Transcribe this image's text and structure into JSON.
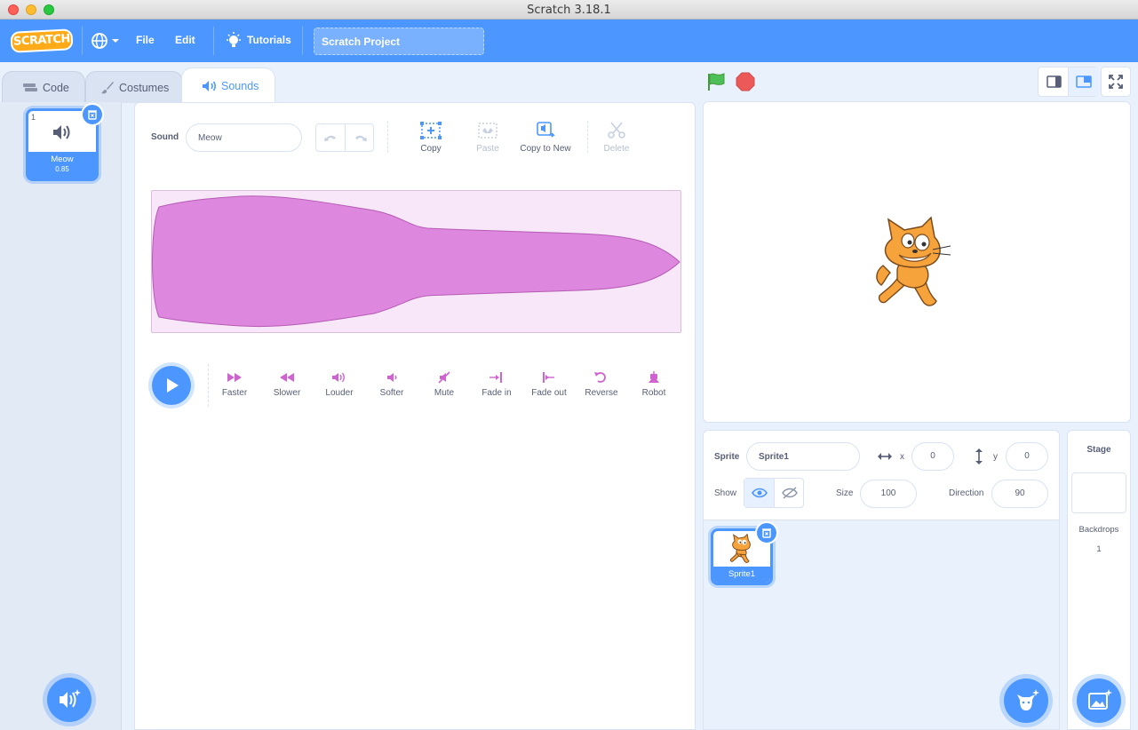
{
  "window": {
    "title": "Scratch 3.18.1"
  },
  "menubar": {
    "logo_text": "SCRATCH",
    "file_label": "File",
    "edit_label": "Edit",
    "tutorials_label": "Tutorials",
    "project_title": "Scratch Project"
  },
  "tabs": {
    "code": "Code",
    "costumes": "Costumes",
    "sounds": "Sounds"
  },
  "sound_list": {
    "items": [
      {
        "index": "1",
        "name": "Meow",
        "duration": "0.85"
      }
    ]
  },
  "sound_editor": {
    "sound_label": "Sound",
    "sound_name": "Meow",
    "toolbar": {
      "copy": "Copy",
      "paste": "Paste",
      "copy_to_new": "Copy to New",
      "delete": "Delete"
    },
    "effects": [
      "Faster",
      "Slower",
      "Louder",
      "Softer",
      "Mute",
      "Fade in",
      "Fade out",
      "Reverse",
      "Robot"
    ]
  },
  "sprite_info": {
    "sprite_label": "Sprite",
    "sprite_name": "Sprite1",
    "x_label": "x",
    "x_value": "0",
    "y_label": "y",
    "y_value": "0",
    "show_label": "Show",
    "size_label": "Size",
    "size_value": "100",
    "direction_label": "Direction",
    "direction_value": "90"
  },
  "sprites": [
    {
      "name": "Sprite1"
    }
  ],
  "stage_pane": {
    "title": "Stage",
    "backdrops_label": "Backdrops",
    "backdrops_count": "1"
  },
  "colors": {
    "primary": "#4c97ff",
    "sound_pink": "#cf63cf",
    "wave_fill": "#de87de",
    "wave_bg": "#f8e7f8",
    "flag_green": "#4cbf56",
    "stop_red": "#ec5959"
  }
}
